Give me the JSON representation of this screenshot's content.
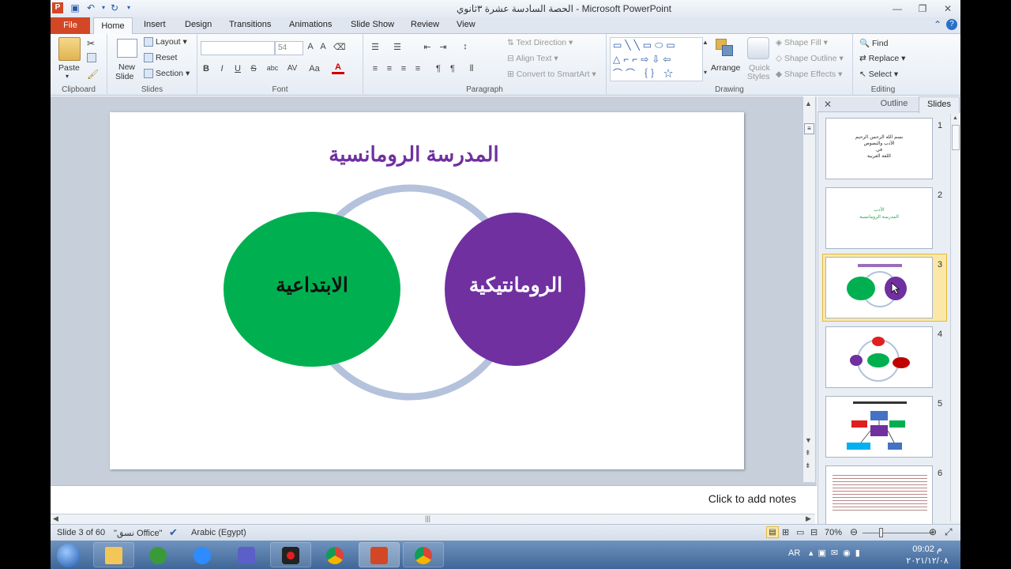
{
  "window": {
    "title": "الحصة السادسة عشرة ٣ثانوي - Microsoft PowerPoint"
  },
  "tabs": [
    "File",
    "Home",
    "Insert",
    "Design",
    "Transitions",
    "Animations",
    "Slide Show",
    "Review",
    "View"
  ],
  "ribbon": {
    "clipboard": {
      "paste": "Paste",
      "label": "Clipboard"
    },
    "slides": {
      "new_slide_line1": "New",
      "new_slide_line2": "Slide",
      "layout": "Layout",
      "reset": "Reset",
      "section": "Section",
      "label": "Slides"
    },
    "font": {
      "font_size": "54",
      "label": "Font",
      "bold": "B",
      "italic": "I",
      "underline": "U",
      "strike": "S",
      "shadow": "abc",
      "spacing": "AV",
      "case": "Aa",
      "color": "A"
    },
    "paragraph": {
      "text_direction": "Text Direction",
      "align_text": "Align Text",
      "convert_smartart": "Convert to SmartArt",
      "label": "Paragraph"
    },
    "drawing": {
      "arrange": "Arrange",
      "quick_styles_1": "Quick",
      "quick_styles_2": "Styles",
      "shape_fill": "Shape Fill",
      "shape_outline": "Shape Outline",
      "shape_effects": "Shape Effects",
      "label": "Drawing"
    },
    "editing": {
      "find": "Find",
      "replace": "Replace",
      "select": "Select",
      "label": "Editing"
    }
  },
  "slide": {
    "title": "المدرسة الرومانسية",
    "left_circle": "الابتداعية",
    "right_circle": "الرومانتيكية",
    "colors": {
      "title": "#7030a0",
      "green": "#00b050",
      "purple": "#7030a0",
      "ring": "#b4c2dc"
    }
  },
  "notes": {
    "placeholder": "Click to add notes"
  },
  "panel": {
    "tab_outline": "Outline",
    "tab_slides": "Slides",
    "thumbnails": [
      {
        "number": "1",
        "lines": [
          "بسم الله الرحمن الرحيم",
          "الأدب والنصوص",
          "في",
          "اللغة العربية"
        ]
      },
      {
        "number": "2",
        "lines": [
          "الأدب",
          "المدرسة الرومانسية"
        ]
      },
      {
        "number": "3"
      },
      {
        "number": "4"
      },
      {
        "number": "5"
      },
      {
        "number": "6"
      }
    ]
  },
  "status": {
    "slide_info": "Slide 3 of 60",
    "theme": "\"نسق Office\"",
    "language": "Arabic (Egypt)",
    "zoom": "70%"
  },
  "taskbar": {
    "lang": "AR",
    "time": "09:02 م",
    "date": "٢٠٢١/١٢/٠٨"
  }
}
